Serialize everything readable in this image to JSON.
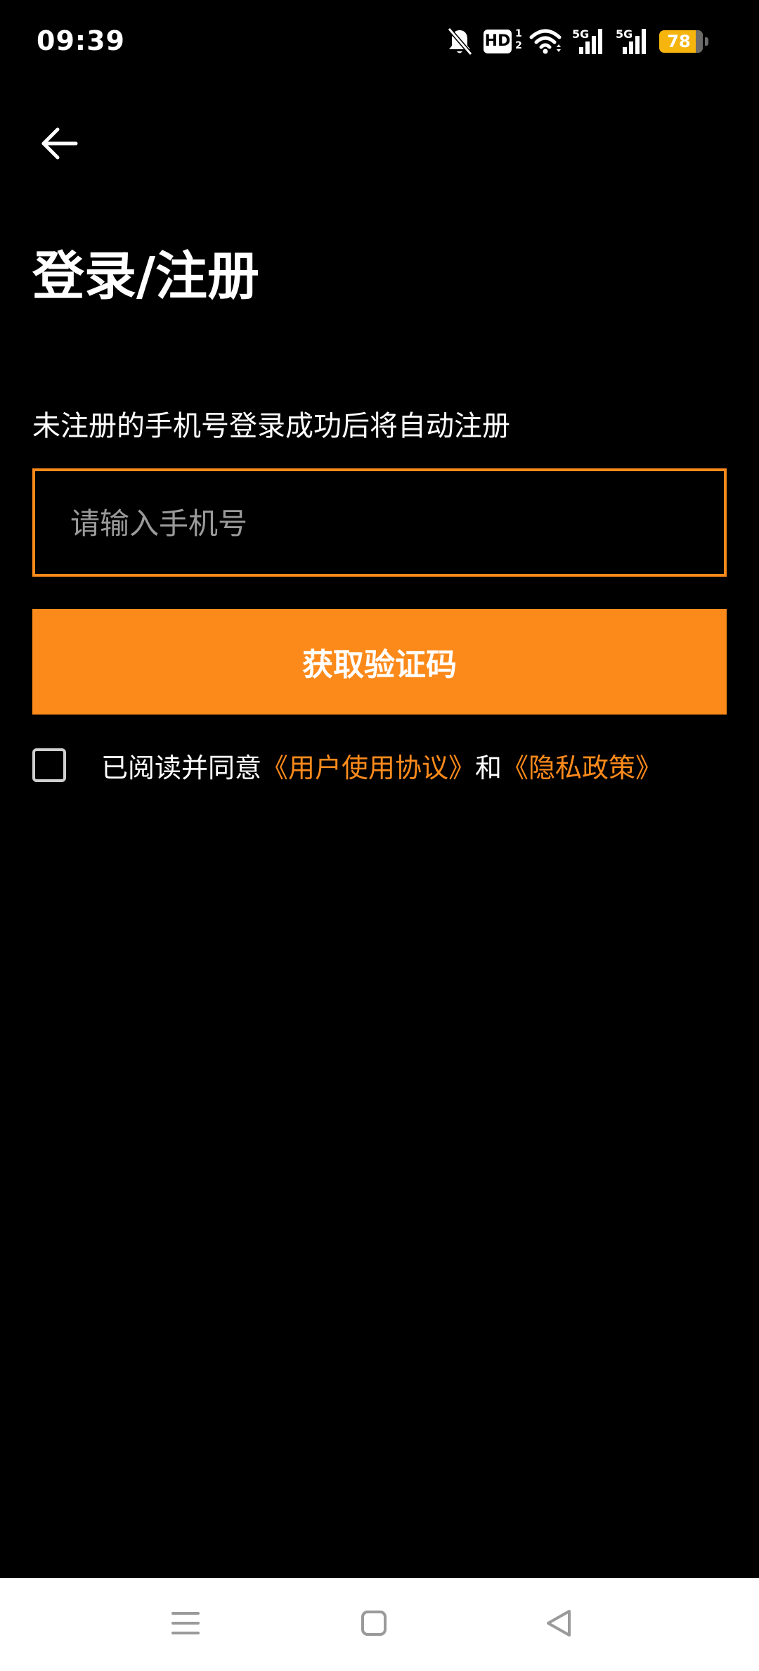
{
  "status_bar": {
    "time": "09:39",
    "icons": [
      "bell-off-icon",
      "hd-icon",
      "wifi-icon",
      "signal-5g-icon",
      "signal-5g-icon",
      "battery-icon"
    ],
    "hd_label": "HD",
    "hd_sub_top": "1",
    "hd_sub_bottom": "2",
    "net_label_1": "5G",
    "net_label_2": "5G",
    "battery_level": "78"
  },
  "header": {
    "back_icon": "arrow-left-icon"
  },
  "main": {
    "title": "登录/注册",
    "hint": "未注册的手机号登录成功后将自动注册",
    "phone_input": {
      "value": "",
      "placeholder": "请输入手机号"
    },
    "get_code_label": "获取验证码",
    "agreement": {
      "checked": false,
      "prefix": "已阅读并同意",
      "user_agreement": "《用户使用协议》",
      "connector": "和",
      "privacy_policy": "《隐私政策》"
    }
  },
  "nav_bar": {
    "menu_icon": "menu-icon",
    "home_icon": "home-square-icon",
    "back_icon": "back-triangle-icon"
  },
  "colors": {
    "accent": "#fc8a1b",
    "background": "#000000",
    "battery": "#f5b50d"
  }
}
